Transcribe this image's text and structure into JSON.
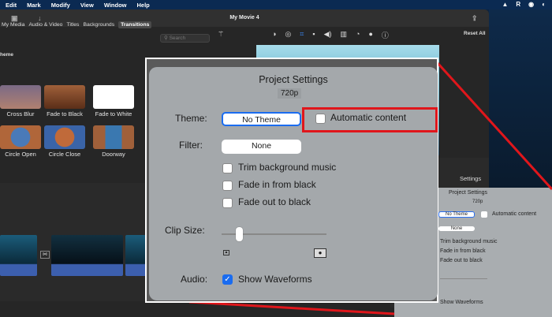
{
  "menubar": {
    "items": [
      "Edit",
      "Mark",
      "Modify",
      "View",
      "Window",
      "Help"
    ]
  },
  "window": {
    "title": "My Movie 4"
  },
  "browser": {
    "tabs": [
      "My Media",
      "Audio & Video",
      "Titles",
      "Backgrounds",
      "Transitions"
    ],
    "selected_tab": "Transitions",
    "search_placeholder": "Search",
    "section": "heme",
    "transitions": [
      "Cross Blur",
      "Fade to Black",
      "Fade to White",
      "Circle Open",
      "Circle Close",
      "Doorway"
    ]
  },
  "viewer": {
    "reset_all": "Reset All",
    "settings_tab": "Settings"
  },
  "project_settings": {
    "title": "Project Settings",
    "resolution": "720p",
    "theme_label": "Theme:",
    "theme_value": "No Theme",
    "automatic_content": "Automatic content",
    "automatic_content_checked": false,
    "filter_label": "Filter:",
    "filter_value": "None",
    "trim_music": "Trim background music",
    "fade_in": "Fade in from black",
    "fade_out": "Fade out to black",
    "clip_size_label": "Clip Size:",
    "clip_size_fraction": 0.18,
    "audio_label": "Audio:",
    "show_waveforms": "Show Waveforms",
    "show_waveforms_checked": true
  },
  "colors": {
    "highlight": "#e0161b",
    "accent": "#1a6cf0"
  }
}
